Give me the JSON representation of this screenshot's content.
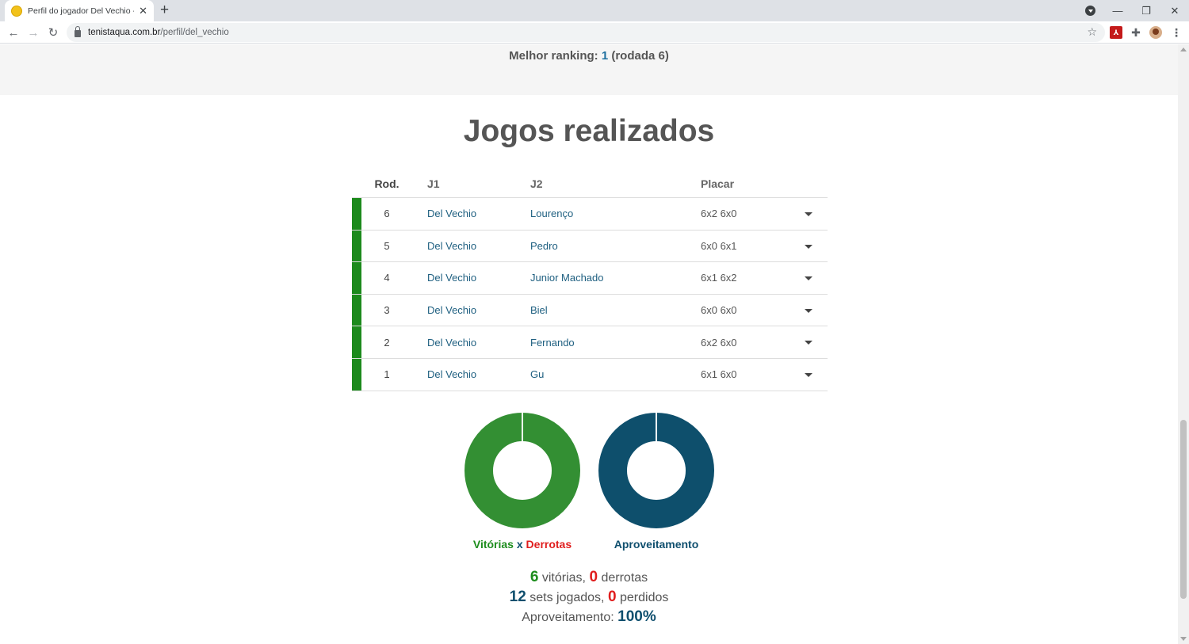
{
  "browser": {
    "tab_title": "Perfil do jogador Del Vechio - Te",
    "url_host": "tenistaqua.com.br",
    "url_path": "/perfil/del_vechio"
  },
  "ranking": {
    "label": "Melhor ranking:",
    "value": "1",
    "detail": "(rodada 6)"
  },
  "title": "Jogos realizados",
  "table": {
    "headers": {
      "rod": "Rod.",
      "j1": "J1",
      "j2": "J2",
      "placar": "Placar"
    },
    "rows": [
      {
        "rod": "6",
        "j1": "Del Vechio",
        "j2": "Lourenço",
        "placar": "6x2 6x0"
      },
      {
        "rod": "5",
        "j1": "Del Vechio",
        "j2": "Pedro",
        "placar": "6x0 6x1"
      },
      {
        "rod": "4",
        "j1": "Del Vechio",
        "j2": "Junior Machado",
        "placar": "6x1 6x2"
      },
      {
        "rod": "3",
        "j1": "Del Vechio",
        "j2": "Biel",
        "placar": "6x0 6x0"
      },
      {
        "rod": "2",
        "j1": "Del Vechio",
        "j2": "Fernando",
        "placar": "6x2 6x0"
      },
      {
        "rod": "1",
        "j1": "Del Vechio",
        "j2": "Gu",
        "placar": "6x1 6x0"
      }
    ]
  },
  "charts": {
    "wins_losses": {
      "label_a": "Vitórias",
      "label_sep": "x",
      "label_b": "Derrotas",
      "values": [
        6,
        0
      ],
      "colors": [
        "#338f33",
        "#e01e1e"
      ]
    },
    "performance": {
      "label": "Aproveitamento",
      "values": [
        100,
        0
      ],
      "colors": [
        "#0e4f6c",
        "#dddddd"
      ]
    }
  },
  "stats": {
    "wins": "6",
    "wins_label": "vitórias,",
    "losses": "0",
    "losses_label": "derrotas",
    "sets": "12",
    "sets_label": "sets jogados,",
    "lost_sets": "0",
    "lost_label": "perdidos",
    "perf_label": "Aproveitamento:",
    "perf_value": "100%"
  }
}
